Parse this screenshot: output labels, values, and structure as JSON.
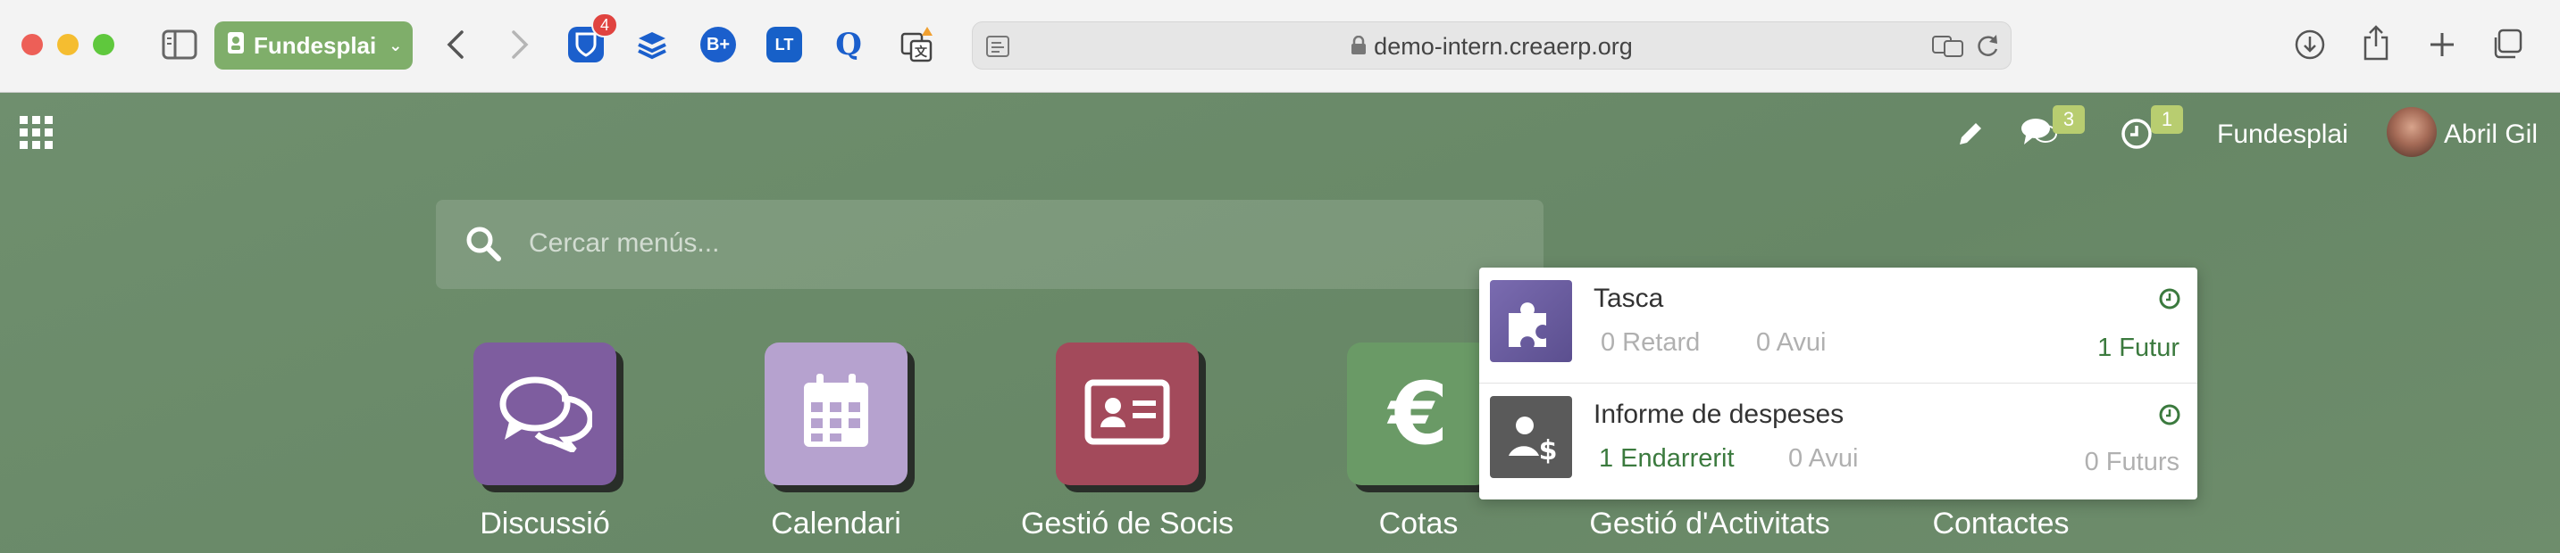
{
  "browser": {
    "profile": "Fundesplai",
    "url": "demo-intern.creaerp.org",
    "bitwarden_badge": "4"
  },
  "navbar": {
    "messages_count": "3",
    "activities_count": "1",
    "company": "Fundesplai",
    "user": "Abril Gil"
  },
  "search": {
    "placeholder": "Cercar menús..."
  },
  "apps": [
    {
      "label": "Discussió",
      "color": "#7e5d9f"
    },
    {
      "label": "Calendari",
      "color": "#b6a2cf"
    },
    {
      "label": "Gestió de Socis",
      "color": "#a34a5b"
    },
    {
      "label": "Cotas",
      "color": "#6a9a66"
    },
    {
      "label": "Gestió d'Activitats",
      "color": "#8e5060"
    },
    {
      "label": "Contactes",
      "color": "#a88cc6"
    }
  ],
  "activities": [
    {
      "name": "Tasca",
      "late": "0 Retard",
      "today": "0 Avui",
      "future": "1 Futur"
    },
    {
      "name": "Informe de despeses",
      "late": "1 Endarrerit",
      "today": "0 Avui",
      "future": "0 Futurs"
    }
  ]
}
